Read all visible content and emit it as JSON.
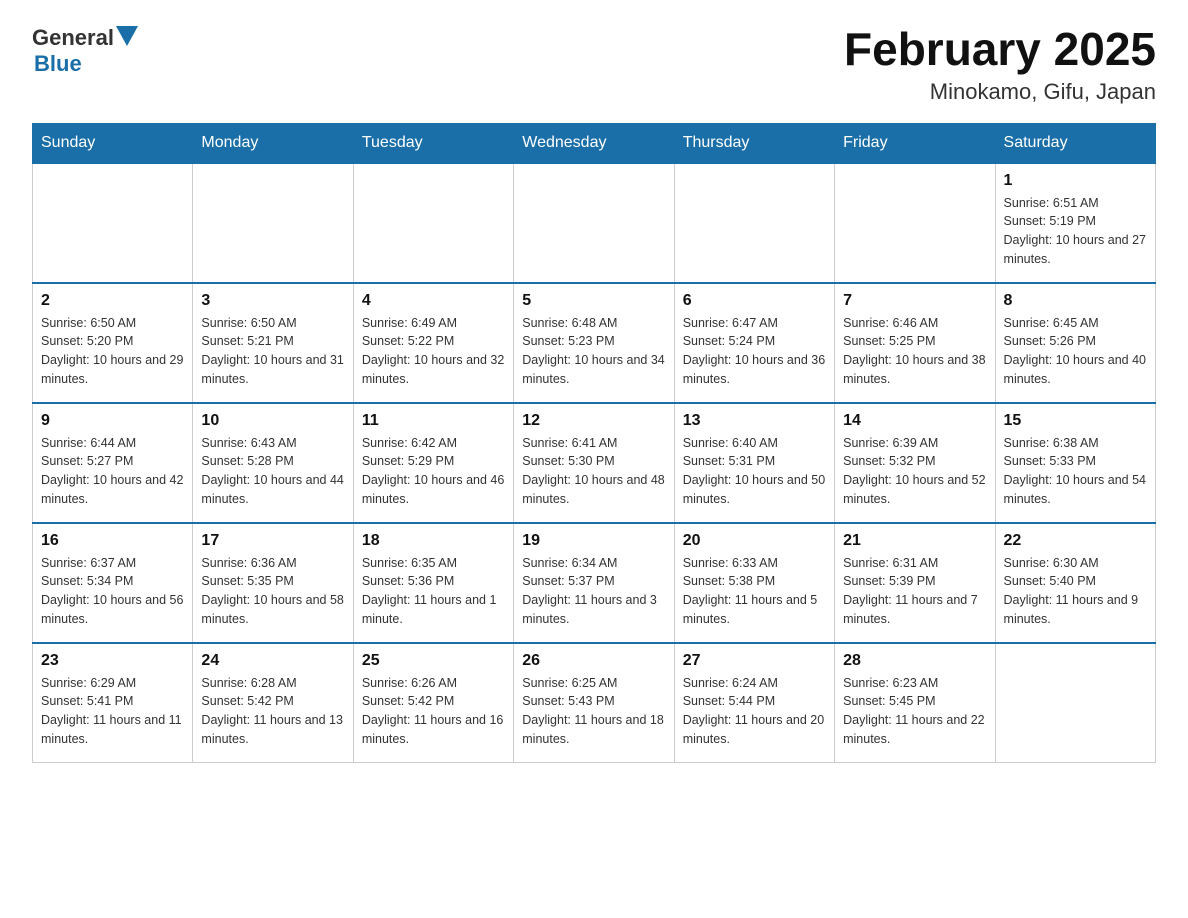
{
  "logo": {
    "general": "General",
    "blue": "Blue"
  },
  "title": "February 2025",
  "subtitle": "Minokamo, Gifu, Japan",
  "weekdays": [
    "Sunday",
    "Monday",
    "Tuesday",
    "Wednesday",
    "Thursday",
    "Friday",
    "Saturday"
  ],
  "weeks": [
    [
      {
        "day": "",
        "sunrise": "",
        "sunset": "",
        "daylight": ""
      },
      {
        "day": "",
        "sunrise": "",
        "sunset": "",
        "daylight": ""
      },
      {
        "day": "",
        "sunrise": "",
        "sunset": "",
        "daylight": ""
      },
      {
        "day": "",
        "sunrise": "",
        "sunset": "",
        "daylight": ""
      },
      {
        "day": "",
        "sunrise": "",
        "sunset": "",
        "daylight": ""
      },
      {
        "day": "",
        "sunrise": "",
        "sunset": "",
        "daylight": ""
      },
      {
        "day": "1",
        "sunrise": "Sunrise: 6:51 AM",
        "sunset": "Sunset: 5:19 PM",
        "daylight": "Daylight: 10 hours and 27 minutes."
      }
    ],
    [
      {
        "day": "2",
        "sunrise": "Sunrise: 6:50 AM",
        "sunset": "Sunset: 5:20 PM",
        "daylight": "Daylight: 10 hours and 29 minutes."
      },
      {
        "day": "3",
        "sunrise": "Sunrise: 6:50 AM",
        "sunset": "Sunset: 5:21 PM",
        "daylight": "Daylight: 10 hours and 31 minutes."
      },
      {
        "day": "4",
        "sunrise": "Sunrise: 6:49 AM",
        "sunset": "Sunset: 5:22 PM",
        "daylight": "Daylight: 10 hours and 32 minutes."
      },
      {
        "day": "5",
        "sunrise": "Sunrise: 6:48 AM",
        "sunset": "Sunset: 5:23 PM",
        "daylight": "Daylight: 10 hours and 34 minutes."
      },
      {
        "day": "6",
        "sunrise": "Sunrise: 6:47 AM",
        "sunset": "Sunset: 5:24 PM",
        "daylight": "Daylight: 10 hours and 36 minutes."
      },
      {
        "day": "7",
        "sunrise": "Sunrise: 6:46 AM",
        "sunset": "Sunset: 5:25 PM",
        "daylight": "Daylight: 10 hours and 38 minutes."
      },
      {
        "day": "8",
        "sunrise": "Sunrise: 6:45 AM",
        "sunset": "Sunset: 5:26 PM",
        "daylight": "Daylight: 10 hours and 40 minutes."
      }
    ],
    [
      {
        "day": "9",
        "sunrise": "Sunrise: 6:44 AM",
        "sunset": "Sunset: 5:27 PM",
        "daylight": "Daylight: 10 hours and 42 minutes."
      },
      {
        "day": "10",
        "sunrise": "Sunrise: 6:43 AM",
        "sunset": "Sunset: 5:28 PM",
        "daylight": "Daylight: 10 hours and 44 minutes."
      },
      {
        "day": "11",
        "sunrise": "Sunrise: 6:42 AM",
        "sunset": "Sunset: 5:29 PM",
        "daylight": "Daylight: 10 hours and 46 minutes."
      },
      {
        "day": "12",
        "sunrise": "Sunrise: 6:41 AM",
        "sunset": "Sunset: 5:30 PM",
        "daylight": "Daylight: 10 hours and 48 minutes."
      },
      {
        "day": "13",
        "sunrise": "Sunrise: 6:40 AM",
        "sunset": "Sunset: 5:31 PM",
        "daylight": "Daylight: 10 hours and 50 minutes."
      },
      {
        "day": "14",
        "sunrise": "Sunrise: 6:39 AM",
        "sunset": "Sunset: 5:32 PM",
        "daylight": "Daylight: 10 hours and 52 minutes."
      },
      {
        "day": "15",
        "sunrise": "Sunrise: 6:38 AM",
        "sunset": "Sunset: 5:33 PM",
        "daylight": "Daylight: 10 hours and 54 minutes."
      }
    ],
    [
      {
        "day": "16",
        "sunrise": "Sunrise: 6:37 AM",
        "sunset": "Sunset: 5:34 PM",
        "daylight": "Daylight: 10 hours and 56 minutes."
      },
      {
        "day": "17",
        "sunrise": "Sunrise: 6:36 AM",
        "sunset": "Sunset: 5:35 PM",
        "daylight": "Daylight: 10 hours and 58 minutes."
      },
      {
        "day": "18",
        "sunrise": "Sunrise: 6:35 AM",
        "sunset": "Sunset: 5:36 PM",
        "daylight": "Daylight: 11 hours and 1 minute."
      },
      {
        "day": "19",
        "sunrise": "Sunrise: 6:34 AM",
        "sunset": "Sunset: 5:37 PM",
        "daylight": "Daylight: 11 hours and 3 minutes."
      },
      {
        "day": "20",
        "sunrise": "Sunrise: 6:33 AM",
        "sunset": "Sunset: 5:38 PM",
        "daylight": "Daylight: 11 hours and 5 minutes."
      },
      {
        "day": "21",
        "sunrise": "Sunrise: 6:31 AM",
        "sunset": "Sunset: 5:39 PM",
        "daylight": "Daylight: 11 hours and 7 minutes."
      },
      {
        "day": "22",
        "sunrise": "Sunrise: 6:30 AM",
        "sunset": "Sunset: 5:40 PM",
        "daylight": "Daylight: 11 hours and 9 minutes."
      }
    ],
    [
      {
        "day": "23",
        "sunrise": "Sunrise: 6:29 AM",
        "sunset": "Sunset: 5:41 PM",
        "daylight": "Daylight: 11 hours and 11 minutes."
      },
      {
        "day": "24",
        "sunrise": "Sunrise: 6:28 AM",
        "sunset": "Sunset: 5:42 PM",
        "daylight": "Daylight: 11 hours and 13 minutes."
      },
      {
        "day": "25",
        "sunrise": "Sunrise: 6:26 AM",
        "sunset": "Sunset: 5:42 PM",
        "daylight": "Daylight: 11 hours and 16 minutes."
      },
      {
        "day": "26",
        "sunrise": "Sunrise: 6:25 AM",
        "sunset": "Sunset: 5:43 PM",
        "daylight": "Daylight: 11 hours and 18 minutes."
      },
      {
        "day": "27",
        "sunrise": "Sunrise: 6:24 AM",
        "sunset": "Sunset: 5:44 PM",
        "daylight": "Daylight: 11 hours and 20 minutes."
      },
      {
        "day": "28",
        "sunrise": "Sunrise: 6:23 AM",
        "sunset": "Sunset: 5:45 PM",
        "daylight": "Daylight: 11 hours and 22 minutes."
      },
      {
        "day": "",
        "sunrise": "",
        "sunset": "",
        "daylight": ""
      }
    ]
  ]
}
